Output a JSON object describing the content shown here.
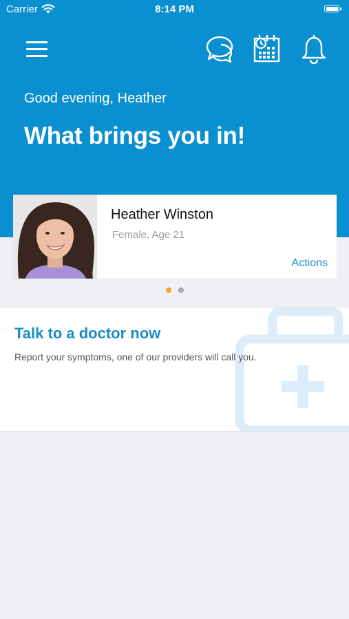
{
  "status_bar": {
    "carrier": "Carrier",
    "time": "8:14 PM"
  },
  "header": {
    "background_color": "#0a8fd0",
    "icons": [
      "menu-icon",
      "chat-icon",
      "calendar-icon",
      "bell-icon"
    ],
    "greeting": "Good evening, Heather",
    "headline": "What brings you in!"
  },
  "profile_card": {
    "name": "Heather Winston",
    "detail": "Female, Age 21",
    "actions_label": "Actions"
  },
  "carousel": {
    "pages": 2,
    "active_page": 1,
    "active_color": "#f5a23a",
    "inactive_color": "#a8a8a8"
  },
  "doctor_card": {
    "title": "Talk to a doctor now",
    "description": "Report your symptoms, one of our providers will call you.",
    "title_color": "#1b8bc7",
    "icon": "medkit-icon"
  }
}
